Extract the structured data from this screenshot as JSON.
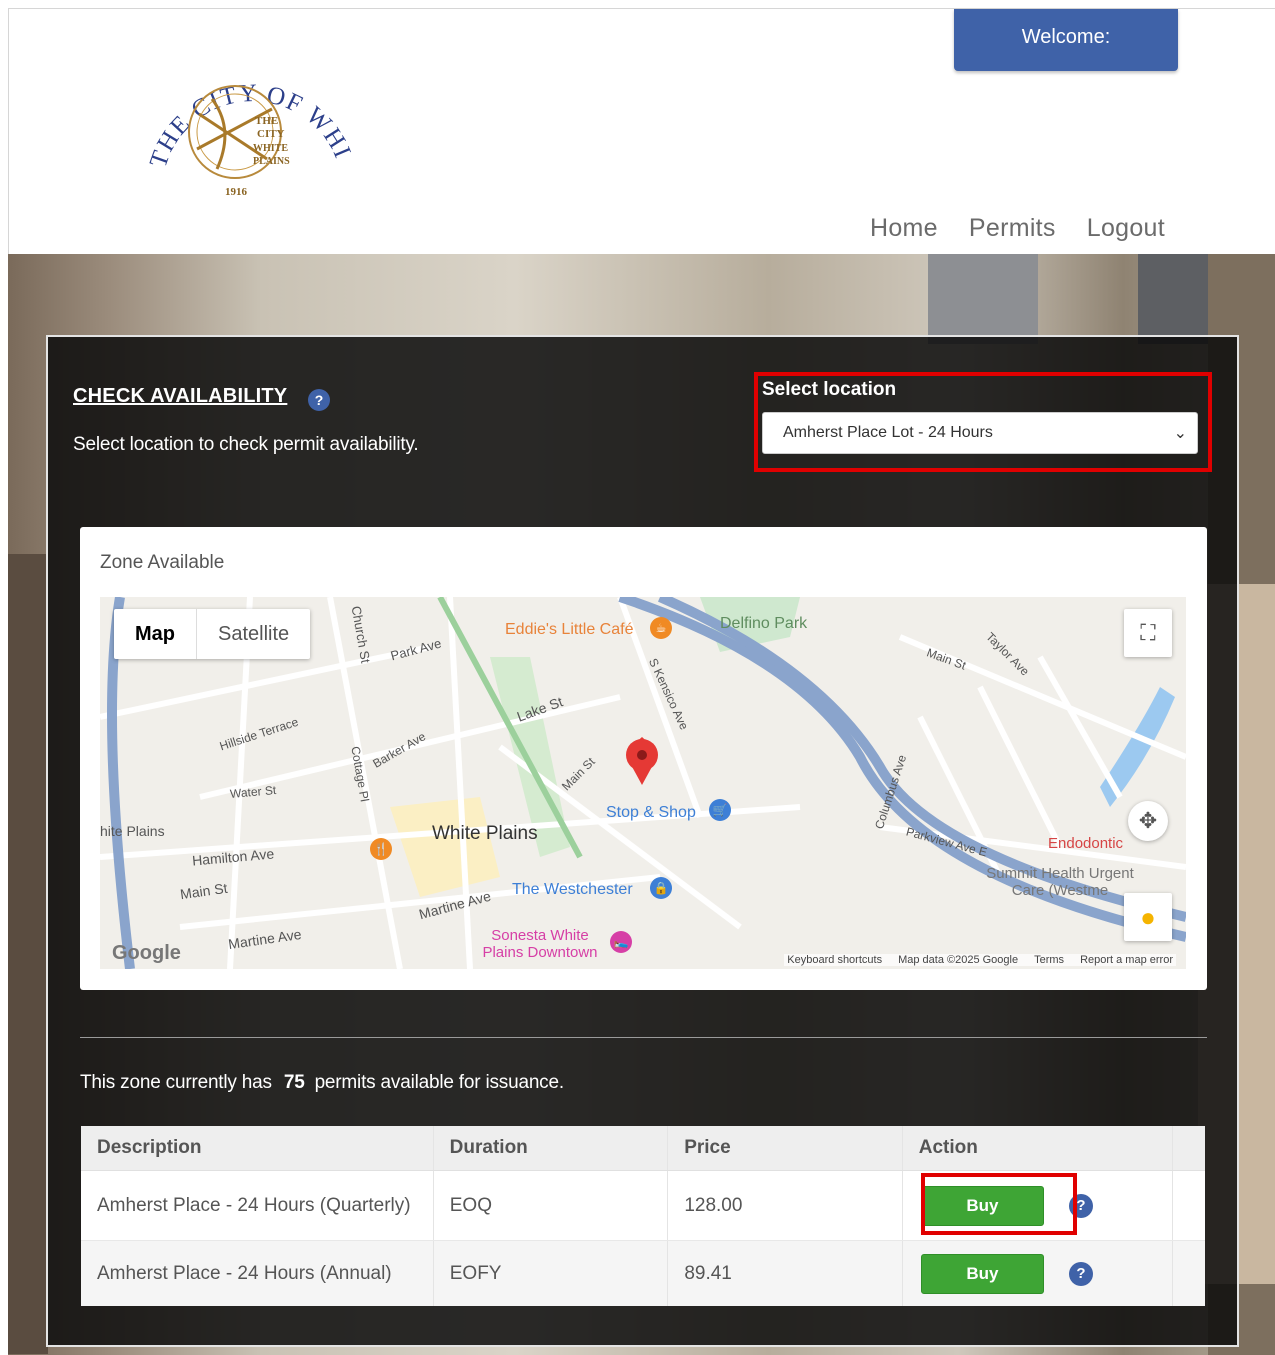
{
  "header": {
    "logo_text": "THE CITY OF WHITE PLAINS",
    "welcome_label": "Welcome:",
    "nav": [
      "Home",
      "Permits",
      "Logout"
    ]
  },
  "availability": {
    "title": "CHECK AVAILABILITY",
    "help_glyph": "?",
    "subtitle": "Select location to check permit availability.",
    "location_label": "Select location",
    "location_selected": "Amherst Place Lot - 24 Hours"
  },
  "zone": {
    "title": "Zone Available",
    "map": {
      "tab_map": "Map",
      "tab_satellite": "Satellite",
      "footer": [
        "Keyboard shortcuts",
        "Map data ©2025 Google",
        "Terms",
        "Report a map error"
      ],
      "google": "Google",
      "labels": {
        "white_plains": "White Plains",
        "eddies": "Eddie's Little Café",
        "delfino": "Delfino Park",
        "stop_shop": "Stop & Shop",
        "westchester": "The Westchester",
        "sonesta": "Sonesta White Plains Downtown",
        "summit": "Summit Health Urgent Care (Westme",
        "endodontic": "Endodontic",
        "lake_st": "Lake St",
        "park_ave": "Park Ave",
        "main_st": "Main St",
        "hamilton": "Hamilton Ave",
        "martine": "Martine Ave",
        "martine2": "Martine Ave",
        "hillside": "Hillside Terrace",
        "barker": "Barker Ave",
        "water": "Water St",
        "church": "Church St",
        "cottage": "Cottage Pl",
        "kensico": "S Kensico Ave",
        "main_st2": "Main St",
        "taylor": "Taylor Ave",
        "main_st3": "Main St",
        "columbus": "Columbus Ave",
        "parkview": "Parkview Ave E",
        "white_plains_rail": "hite Plains",
        "main_st_left": "Main St"
      },
      "colors": {
        "highway": "#8aa4cc",
        "park": "#c8e6c9",
        "water": "#9cc9f0",
        "marker": "#e53935"
      }
    }
  },
  "permits": {
    "prefix": "This zone currently has",
    "count": "75",
    "suffix": "permits available for issuance.",
    "headers": [
      "Description",
      "Duration",
      "Price",
      "Action"
    ],
    "rows": [
      {
        "description": "Amherst Place - 24 Hours (Quarterly)",
        "duration": "EOQ",
        "price": "128.00",
        "action": "Buy"
      },
      {
        "description": "Amherst Place - 24 Hours (Annual)",
        "duration": "EOFY",
        "price": "89.41",
        "action": "Buy"
      }
    ]
  },
  "colors": {
    "accent_blue": "#3f62a8",
    "buy_green": "#3ea535",
    "highlight_red": "#e00000"
  }
}
